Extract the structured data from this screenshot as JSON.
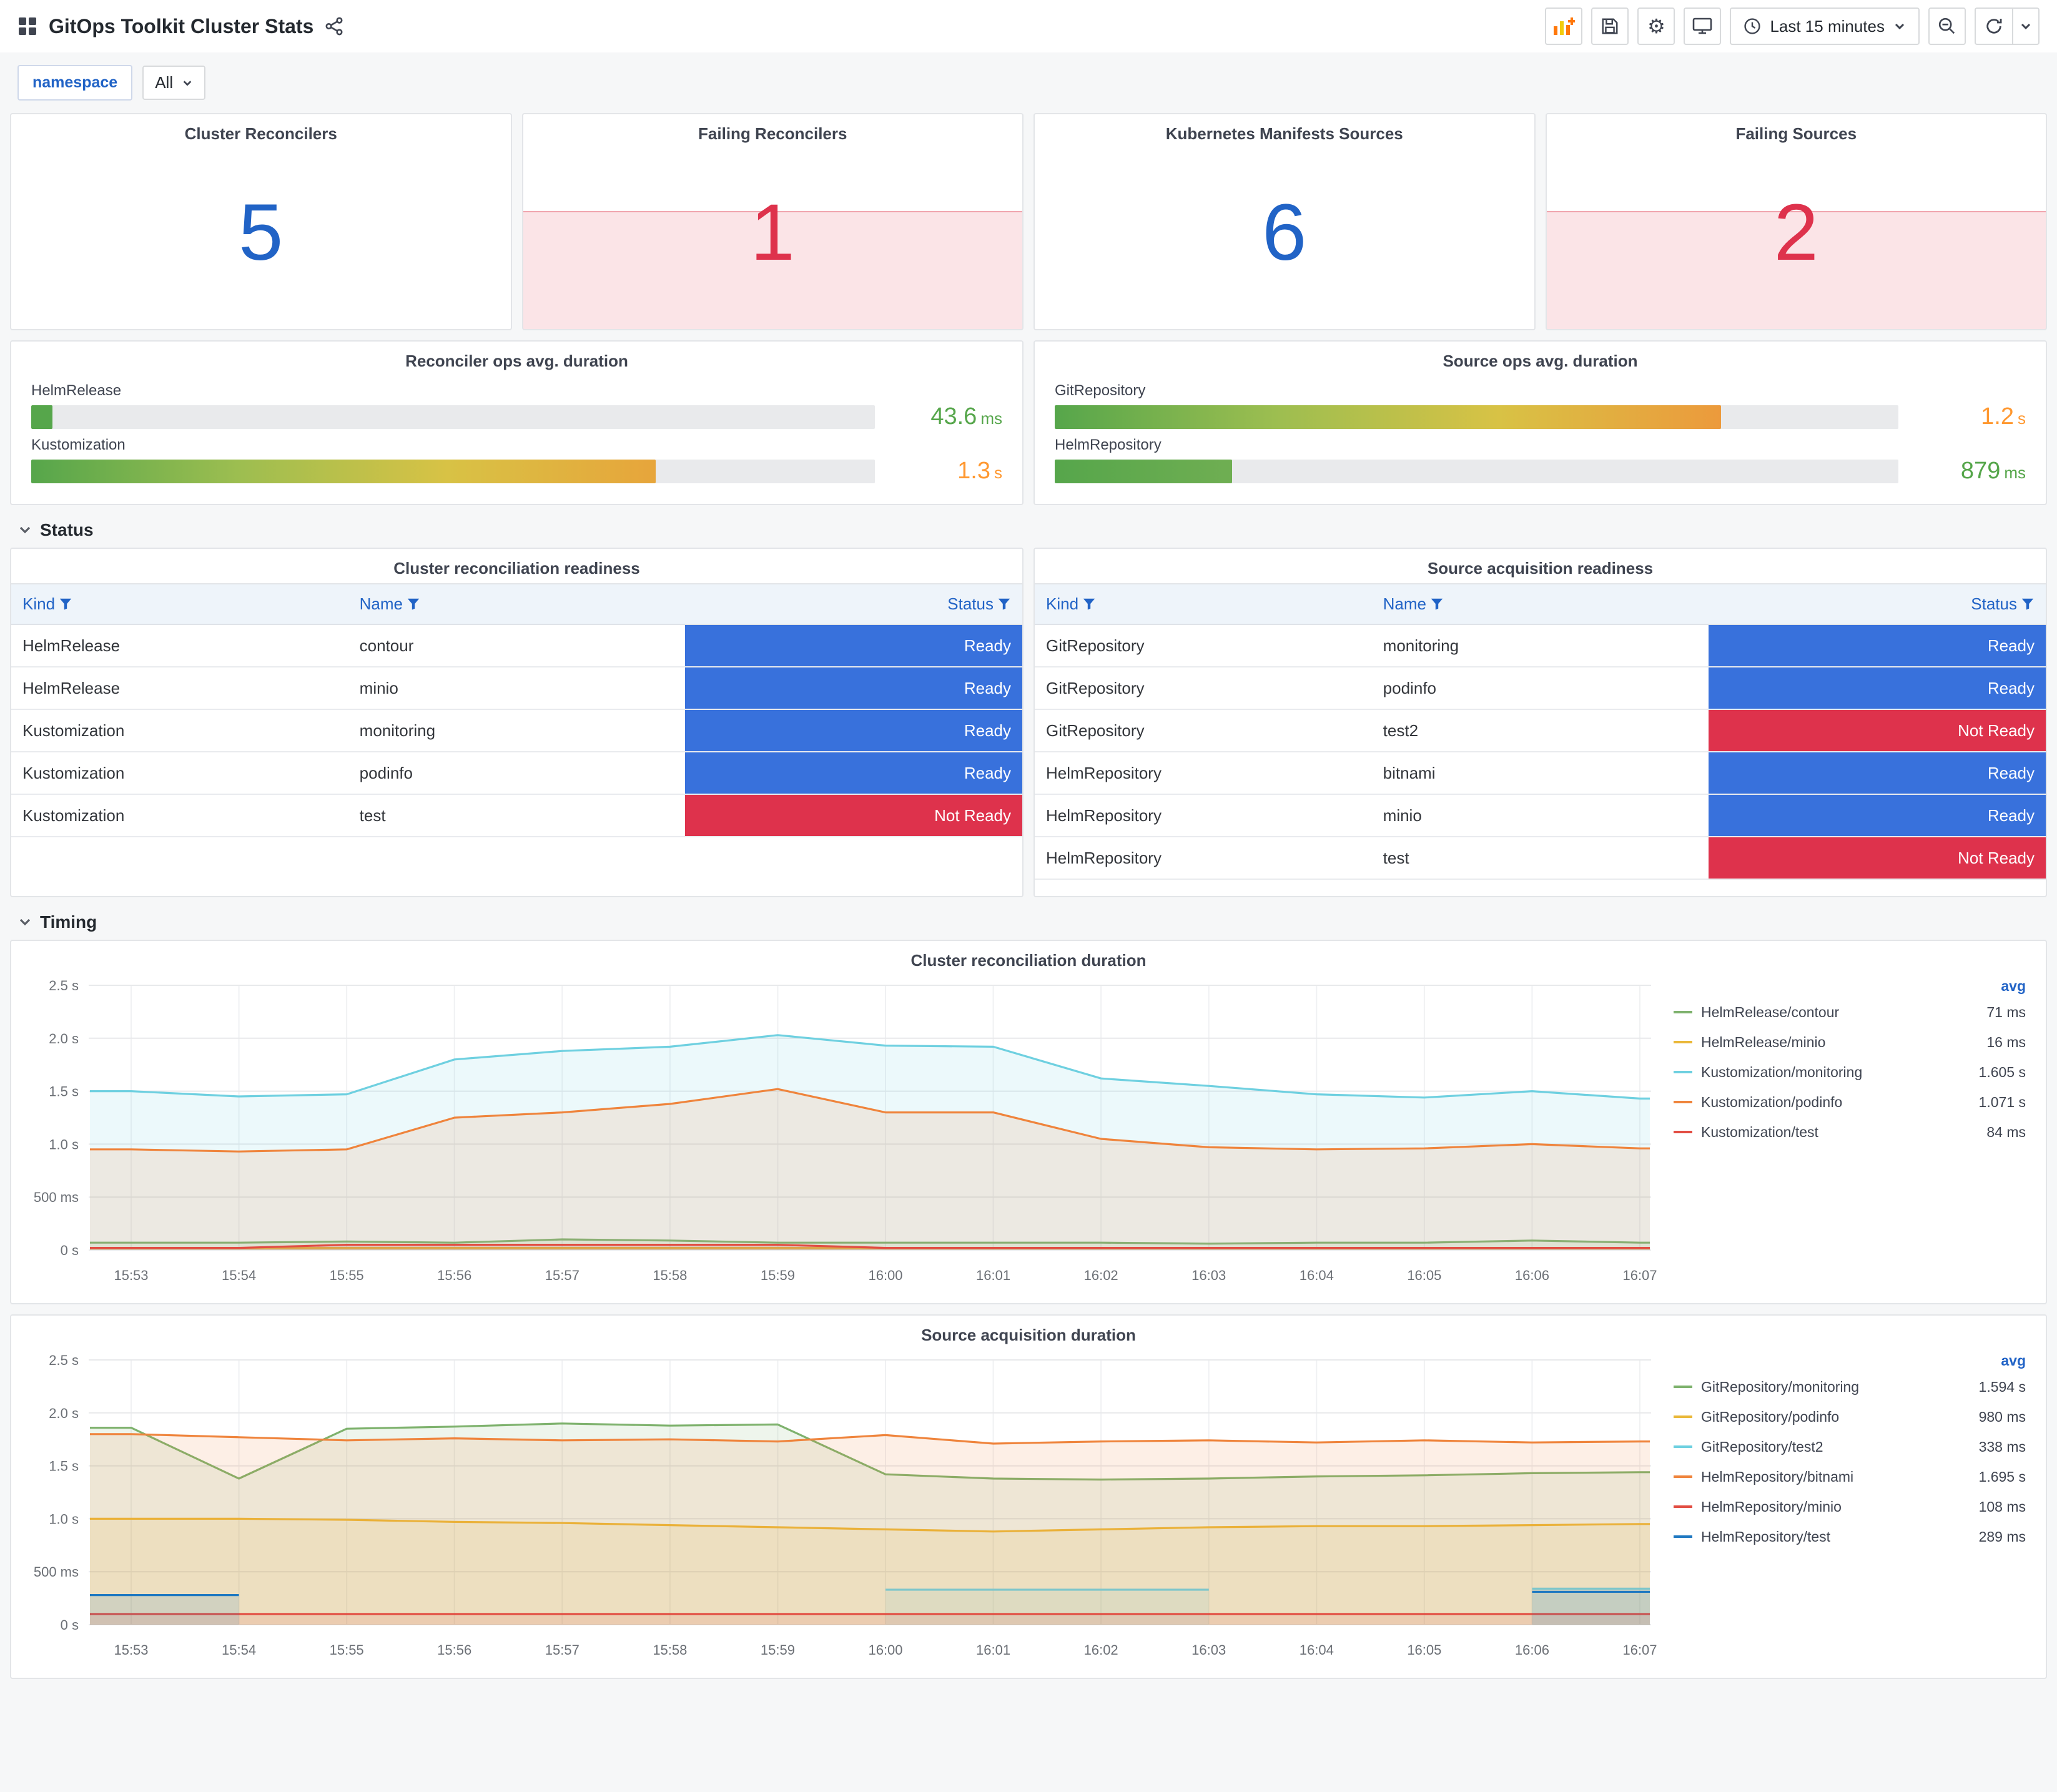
{
  "header": {
    "title": "GitOps Toolkit Cluster Stats",
    "time_range": "Last 15 minutes"
  },
  "toolbar_icons": [
    "dashboards-grid-icon",
    "share-icon",
    "add-panel-icon",
    "save-dashboard-icon",
    "dashboard-settings-icon",
    "cycle-view-icon",
    "clock-icon",
    "caret-down-icon",
    "zoom-out-icon",
    "refresh-icon",
    "refresh-interval-caret-icon"
  ],
  "variables": {
    "label": "namespace",
    "value": "All"
  },
  "sections": {
    "status": "Status",
    "timing": "Timing"
  },
  "stat_panels": [
    {
      "title": "Cluster Reconcilers",
      "value": "5",
      "value_color": "#2163c6",
      "alert": false
    },
    {
      "title": "Failing Reconcilers",
      "value": "1",
      "value_color": "#de324c",
      "alert": true
    },
    {
      "title": "Kubernetes Manifests Sources",
      "value": "6",
      "value_color": "#2163c6",
      "alert": false
    },
    {
      "title": "Failing Sources",
      "value": "2",
      "value_color": "#de324c",
      "alert": true
    }
  ],
  "gauge_panels": [
    {
      "title": "Reconciler ops avg. duration",
      "rows": [
        {
          "label": "HelmRelease",
          "value": "43.6",
          "unit": "ms",
          "percent": 2.5,
          "value_color": "#56A64B",
          "gradient": [
            "#56A64B",
            "#56A64B"
          ]
        },
        {
          "label": "Kustomization",
          "value": "1.3",
          "unit": "s",
          "percent": 74,
          "value_color": "#FF9830",
          "gradient": [
            "#56A64B",
            "#9DBE50",
            "#D8C245",
            "#E7A53B"
          ]
        }
      ]
    },
    {
      "title": "Source ops avg. duration",
      "rows": [
        {
          "label": "GitRepository",
          "value": "1.2",
          "unit": "s",
          "percent": 79,
          "value_color": "#FF9830",
          "gradient": [
            "#56A64B",
            "#9DBE50",
            "#D8C245",
            "#EC9A3C"
          ]
        },
        {
          "label": "HelmRepository",
          "value": "879",
          "unit": "ms",
          "percent": 21,
          "value_color": "#56A64B",
          "gradient": [
            "#56A64B",
            "#6FAE52"
          ]
        }
      ]
    }
  ],
  "status_colors": {
    "Ready": "#3871dc",
    "Not Ready": "#de324c"
  },
  "tables": [
    {
      "title": "Cluster reconciliation readiness",
      "columns": [
        "Kind",
        "Name",
        "Status"
      ],
      "rows": [
        {
          "kind": "HelmRelease",
          "name": "contour",
          "status": "Ready"
        },
        {
          "kind": "HelmRelease",
          "name": "minio",
          "status": "Ready"
        },
        {
          "kind": "Kustomization",
          "name": "monitoring",
          "status": "Ready"
        },
        {
          "kind": "Kustomization",
          "name": "podinfo",
          "status": "Ready"
        },
        {
          "kind": "Kustomization",
          "name": "test",
          "status": "Not Ready"
        }
      ]
    },
    {
      "title": "Source acquisition readiness",
      "columns": [
        "Kind",
        "Name",
        "Status"
      ],
      "rows": [
        {
          "kind": "GitRepository",
          "name": "monitoring",
          "status": "Ready"
        },
        {
          "kind": "GitRepository",
          "name": "podinfo",
          "status": "Ready"
        },
        {
          "kind": "GitRepository",
          "name": "test2",
          "status": "Not Ready"
        },
        {
          "kind": "HelmRepository",
          "name": "bitnami",
          "status": "Ready"
        },
        {
          "kind": "HelmRepository",
          "name": "minio",
          "status": "Ready"
        },
        {
          "kind": "HelmRepository",
          "name": "test",
          "status": "Not Ready"
        }
      ]
    }
  ],
  "chart_data": [
    {
      "type": "line",
      "title": "Cluster reconciliation duration",
      "ylim": [
        0,
        2.5
      ],
      "yticks": [
        {
          "v": 0,
          "label": "0 s"
        },
        {
          "v": 0.5,
          "label": "500 ms"
        },
        {
          "v": 1.0,
          "label": "1.0 s"
        },
        {
          "v": 1.5,
          "label": "1.5 s"
        },
        {
          "v": 2.0,
          "label": "2.0 s"
        },
        {
          "v": 2.5,
          "label": "2.5 s"
        }
      ],
      "x_labels": [
        "15:53",
        "15:54",
        "15:55",
        "15:56",
        "15:57",
        "15:58",
        "15:59",
        "16:00",
        "16:01",
        "16:02",
        "16:03",
        "16:04",
        "16:05",
        "16:06",
        "16:07"
      ],
      "legend_header": "avg",
      "series": [
        {
          "name": "HelmRelease/contour",
          "avg": "71 ms",
          "color": "#7EB26D",
          "values": [
            0.07,
            0.07,
            0.08,
            0.07,
            0.1,
            0.09,
            0.07,
            0.07,
            0.07,
            0.07,
            0.06,
            0.07,
            0.07,
            0.09,
            0.07
          ]
        },
        {
          "name": "HelmRelease/minio",
          "avg": "16 ms",
          "color": "#EAB839",
          "values": [
            0.02,
            0.02,
            0.02,
            0.02,
            0.02,
            0.02,
            0.02,
            0.02,
            0.02,
            0.02,
            0.02,
            0.02,
            0.02,
            0.02,
            0.02
          ]
        },
        {
          "name": "Kustomization/monitoring",
          "avg": "1.605 s",
          "color": "#6ED0E0",
          "values": [
            1.5,
            1.45,
            1.47,
            1.8,
            1.88,
            1.92,
            2.03,
            1.93,
            1.92,
            1.62,
            1.55,
            1.47,
            1.44,
            1.5,
            1.43
          ]
        },
        {
          "name": "Kustomization/podinfo",
          "avg": "1.071 s",
          "color": "#EF843C",
          "values": [
            0.95,
            0.93,
            0.95,
            1.25,
            1.3,
            1.38,
            1.52,
            1.3,
            1.3,
            1.05,
            0.97,
            0.95,
            0.96,
            1.0,
            0.96
          ]
        },
        {
          "name": "Kustomization/test",
          "avg": "84 ms",
          "color": "#E24D42",
          "values": [
            0.02,
            0.02,
            0.05,
            0.05,
            0.05,
            0.05,
            0.05,
            0.02,
            0.02,
            0.02,
            0.02,
            0.02,
            0.02,
            0.02,
            0.02
          ]
        }
      ]
    },
    {
      "type": "line",
      "title": "Source acquisition duration",
      "ylim": [
        0,
        2.5
      ],
      "yticks": [
        {
          "v": 0,
          "label": "0 s"
        },
        {
          "v": 0.5,
          "label": "500 ms"
        },
        {
          "v": 1.0,
          "label": "1.0 s"
        },
        {
          "v": 1.5,
          "label": "1.5 s"
        },
        {
          "v": 2.0,
          "label": "2.0 s"
        },
        {
          "v": 2.5,
          "label": "2.5 s"
        }
      ],
      "x_labels": [
        "15:53",
        "15:54",
        "15:55",
        "15:56",
        "15:57",
        "15:58",
        "15:59",
        "16:00",
        "16:01",
        "16:02",
        "16:03",
        "16:04",
        "16:05",
        "16:06",
        "16:07"
      ],
      "legend_header": "avg",
      "series": [
        {
          "name": "GitRepository/monitoring",
          "avg": "1.594 s",
          "color": "#7EB26D",
          "values": [
            1.86,
            1.38,
            1.85,
            1.87,
            1.9,
            1.88,
            1.89,
            1.42,
            1.38,
            1.37,
            1.38,
            1.4,
            1.41,
            1.43,
            1.44
          ]
        },
        {
          "name": "GitRepository/podinfo",
          "avg": "980 ms",
          "color": "#EAB839",
          "values": [
            1.0,
            1.0,
            0.99,
            0.97,
            0.96,
            0.94,
            0.92,
            0.9,
            0.88,
            0.9,
            0.92,
            0.93,
            0.93,
            0.94,
            0.95
          ]
        },
        {
          "name": "GitRepository/test2",
          "avg": "338 ms",
          "color": "#6ED0E0",
          "values": [
            null,
            null,
            null,
            null,
            null,
            null,
            null,
            0.33,
            0.33,
            0.33,
            0.33,
            null,
            null,
            0.34,
            0.34
          ]
        },
        {
          "name": "HelmRepository/bitnami",
          "avg": "1.695 s",
          "color": "#EF843C",
          "values": [
            1.8,
            1.77,
            1.74,
            1.76,
            1.74,
            1.75,
            1.73,
            1.79,
            1.71,
            1.73,
            1.74,
            1.72,
            1.74,
            1.72,
            1.73
          ]
        },
        {
          "name": "HelmRepository/minio",
          "avg": "108 ms",
          "color": "#E24D42",
          "values": [
            0.1,
            0.1,
            0.1,
            0.1,
            0.1,
            0.1,
            0.1,
            0.1,
            0.1,
            0.1,
            0.1,
            0.1,
            0.1,
            0.1,
            0.1
          ]
        },
        {
          "name": "HelmRepository/test",
          "avg": "289 ms",
          "color": "#1F78C1",
          "values": [
            0.28,
            0.28,
            null,
            null,
            null,
            null,
            null,
            null,
            null,
            null,
            null,
            null,
            null,
            0.31,
            0.31
          ]
        }
      ]
    }
  ]
}
